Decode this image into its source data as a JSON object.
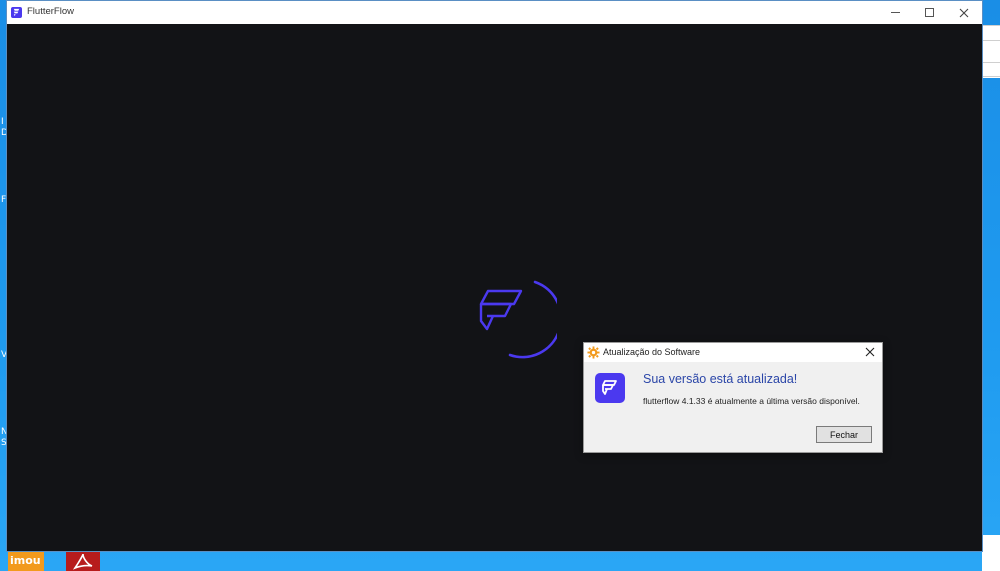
{
  "desktop": {
    "edge_labels": [
      "I",
      "D",
      "Fi",
      "V",
      "N",
      "S"
    ],
    "background_color": "#1c8fe6"
  },
  "taskbar": {
    "imou_label": "imou"
  },
  "window": {
    "title": "FlutterFlow",
    "accent_color": "#4b39ef",
    "content_background": "#121316"
  },
  "loader": {
    "icon": "flutterflow-logo-icon",
    "spinner": "loading-arc"
  },
  "dialog": {
    "title": "Atualização do Software",
    "heading": "Sua versão está atualizada!",
    "message": "flutterflow 4.1.33 é atualmente a última versão disponível.",
    "close_button_label": "Fechar",
    "heading_color": "#2b46a8"
  }
}
